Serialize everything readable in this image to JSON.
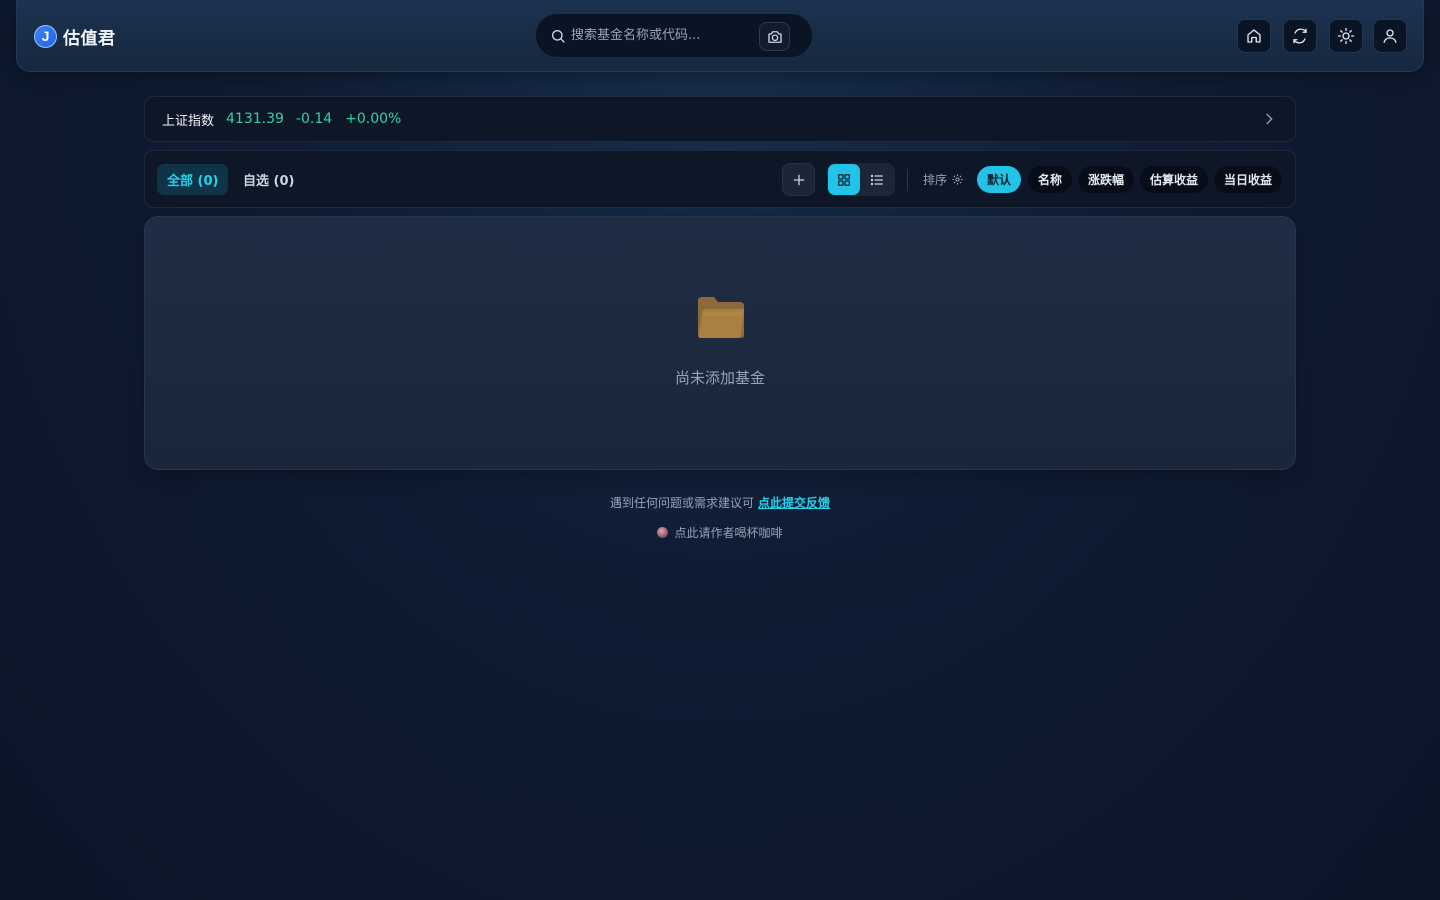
{
  "header": {
    "logo_letter": "J",
    "app_name": "估值君",
    "search_placeholder": "搜索基金名称或代码...",
    "icons": [
      "search-icon",
      "camera-icon",
      "home-icon",
      "refresh-icon",
      "sun-icon",
      "user-icon"
    ]
  },
  "index": {
    "name": "上证指数",
    "value": "4131.39",
    "change": "-0.14",
    "change_pct": "+0.00%",
    "color": "#34d399"
  },
  "tabs": [
    {
      "label": "全部 (0)",
      "active": true
    },
    {
      "label": "自选 (0)",
      "active": false
    }
  ],
  "sort": {
    "label": "排序",
    "options": [
      {
        "label": "默认",
        "active": true
      },
      {
        "label": "名称",
        "active": false
      },
      {
        "label": "涨跌幅",
        "active": false
      },
      {
        "label": "估算收益",
        "active": false
      },
      {
        "label": "当日收益",
        "active": false
      }
    ]
  },
  "empty_state": {
    "text": "尚未添加基金",
    "icon": "folder-icon"
  },
  "footer": {
    "feedback_prefix": "遇到任何问题或需求建议可",
    "feedback_link": "点此提交反馈",
    "coffee_text": "点此请作者喝杯咖啡"
  },
  "colors": {
    "accent": "#22c3e6",
    "positive": "#34d399"
  }
}
